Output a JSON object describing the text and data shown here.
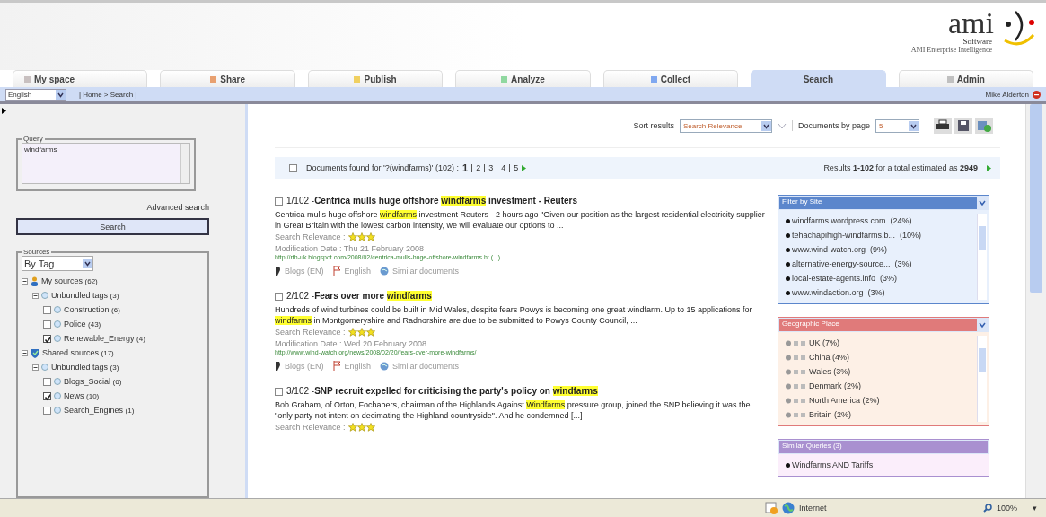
{
  "logo": {
    "name": "ami",
    "sub": "Software",
    "tagline": "AMI Enterprise Intelligence"
  },
  "tabs": [
    {
      "label": "My space",
      "color": "#c8c0c0",
      "selected": false
    },
    {
      "label": "Share",
      "color": "#e8a070",
      "selected": false
    },
    {
      "label": "Publish",
      "color": "#f0d060",
      "selected": false
    },
    {
      "label": "Analyze",
      "color": "#90d8a0",
      "selected": false
    },
    {
      "label": "Collect",
      "color": "#80a8f0",
      "selected": false
    },
    {
      "label": "Search",
      "selected": true
    },
    {
      "label": "Admin",
      "color": "#c0c0c0",
      "selected": false
    }
  ],
  "nav": {
    "language": "English",
    "breadcrumb": "| Home > Search |",
    "user": "Mike Alderton"
  },
  "query": {
    "legend": "Query",
    "value": "windfarms",
    "advanced": "Advanced search",
    "button": "Search"
  },
  "sources": {
    "legend": "Sources",
    "mode": "By Tag",
    "tree": [
      {
        "label": "My sources",
        "count": "(62)",
        "kind": "owner",
        "expanded": true,
        "children": [
          {
            "label": "Unbundled tags",
            "count": "(3)",
            "expanded": true,
            "children": [
              {
                "label": "Construction",
                "count": "(6)",
                "checked": false
              },
              {
                "label": "Police",
                "count": "(43)",
                "checked": false
              },
              {
                "label": "Renewable_Energy",
                "count": "(4)",
                "checked": true
              }
            ]
          }
        ]
      },
      {
        "label": "Shared sources",
        "count": "(17)",
        "kind": "shared",
        "expanded": true,
        "children": [
          {
            "label": "Unbundled tags",
            "count": "(3)",
            "expanded": true,
            "children": [
              {
                "label": "Blogs_Social",
                "count": "(6)",
                "checked": false
              },
              {
                "label": "News",
                "count": "(10)",
                "checked": true
              },
              {
                "label": "Search_Engines",
                "count": "(1)",
                "checked": false
              }
            ]
          }
        ]
      }
    ]
  },
  "toolbar": {
    "sort_label": "Sort results",
    "sort_value": "Search Relevance",
    "per_page_label": "Documents by page",
    "per_page_value": "5"
  },
  "found": {
    "checked": false,
    "text": "Documents found for '?(windfarms)' (102) :",
    "pages": [
      {
        "label": "1",
        "selected": true
      },
      {
        "label": "2",
        "selected": false
      },
      {
        "label": "3",
        "selected": false
      },
      {
        "label": "4",
        "selected": false
      },
      {
        "label": "5",
        "selected": false
      }
    ],
    "results": "Results **1-102** for a total estimated as **2949**"
  },
  "results": [
    {
      "checked": false,
      "number": "1/102 -",
      "title": [
        {
          "text": "Centrica mulls huge offshore ",
          "highlight": false
        },
        {
          "text": "windfarms",
          "highlight": true
        },
        {
          "text": " investment - Reuters",
          "highlight": false
        }
      ],
      "snippet": [
        {
          "text": "Centrica mulls huge offshore ",
          "highlight": false
        },
        {
          "text": "windfarms",
          "highlight": true
        },
        {
          "text": " investment Reuters - 2 hours ago \"Given our position as the largest residential electricity supplier in Great Britain with the lowest carbon intensity, we will evaluate our options to ...",
          "highlight": false
        }
      ],
      "relevance_label": "Search Relevance :",
      "stars": 3,
      "date": "Modification Date : Thu 21 February 2008",
      "url": "http://rth-uk.blogspot.com/2008/02/centrica-mulls-huge-offshore-windfarms.ht (...)",
      "source": "Blogs (EN)",
      "language": "English",
      "similar": "Similar documents"
    },
    {
      "checked": false,
      "number": "2/102 -",
      "title": [
        {
          "text": "Fears over more ",
          "highlight": false
        },
        {
          "text": "windfarms",
          "highlight": true
        }
      ],
      "snippet": [
        {
          "text": "Hundreds of wind turbines could be built in Mid Wales, despite fears Powys is becoming one great windfarm. Up to 15 applications for ",
          "highlight": false
        },
        {
          "text": "windfarms",
          "highlight": true
        },
        {
          "text": " in Montgomeryshire and Radnorshire are due to be submitted to Powys County Council, ...",
          "highlight": false
        }
      ],
      "relevance_label": "Search Relevance :",
      "stars": 3,
      "date": "Modification Date : Wed 20 February 2008",
      "url": "http://www.wind-watch.org/news/2008/02/20/fears-over-more-windfarms/",
      "source": "Blogs (EN)",
      "language": "English",
      "similar": "Similar documents"
    },
    {
      "checked": false,
      "number": "3/102 -",
      "title": [
        {
          "text": "SNP recruit expelled for criticising the party's policy on ",
          "highlight": false
        },
        {
          "text": "windfarms",
          "highlight": true
        }
      ],
      "snippet": [
        {
          "text": "Bob Graham, of Orton, Fochabers, chairman of the Highlands Against ",
          "highlight": false
        },
        {
          "text": "Windfarms",
          "highlight": true
        },
        {
          "text": " pressure group, joined the SNP believing it was the \"only party not intent on decimating the Highland countryside\". And he condemned [...]",
          "highlight": false
        }
      ],
      "relevance_label": "Search Relevance :",
      "stars": 3
    }
  ],
  "panels": [
    {
      "title": "Filter by Site",
      "color": "#5b86cc",
      "kind": "site",
      "items": [
        "windfarms.wordpress.com  (24%)",
        "tehachapihigh-windfarms.b...  (10%)",
        "www.wind-watch.org  (9%)",
        "alternative-energy-source...  (3%)",
        "local-estate-agents.info  (3%)",
        "www.windaction.org  (3%)"
      ]
    },
    {
      "title": "Geographic Place",
      "color": "#e07a7a",
      "kind": "place",
      "items": [
        "UK (7%)",
        "China (4%)",
        "Wales (3%)",
        "Denmark (2%)",
        "North America (2%)",
        "Britain (2%)"
      ]
    },
    {
      "title": "Similar Queries (3)",
      "color": "#a990d0",
      "kind": "queries",
      "items": [
        "Windfarms AND Tariffs"
      ]
    }
  ],
  "status": {
    "zone": "Internet",
    "zoom": "100%",
    "menu": "▾"
  }
}
